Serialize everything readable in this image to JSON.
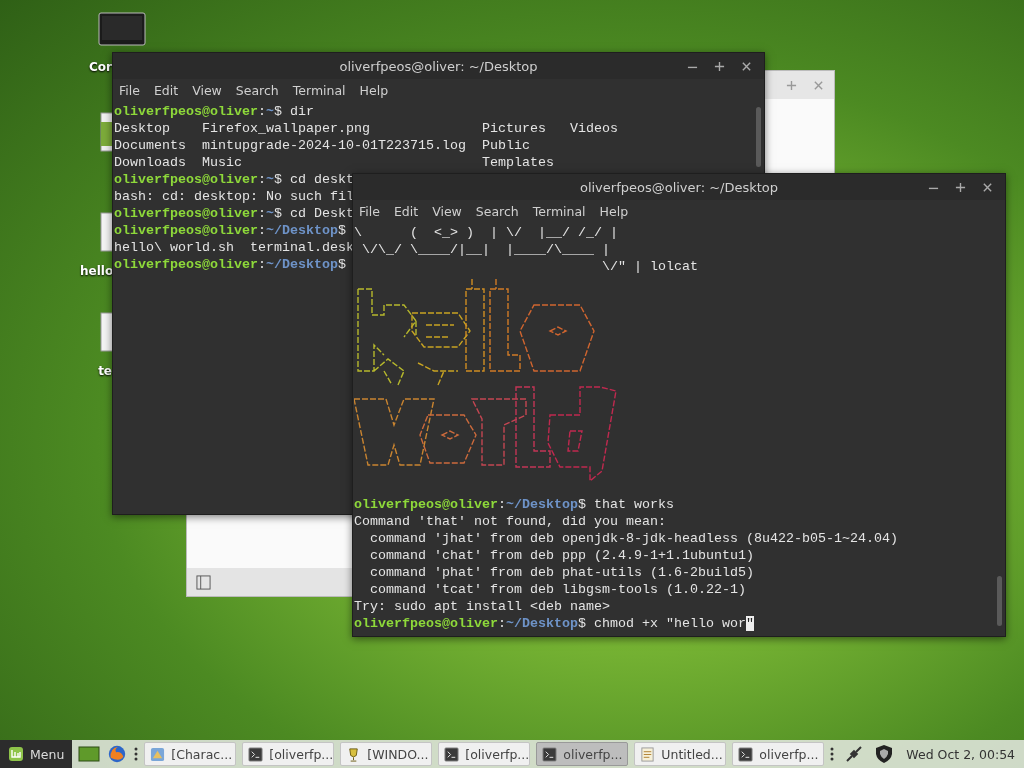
{
  "desktop_icons": [
    {
      "kind": "monitor",
      "label": "Cor"
    },
    {
      "kind": "sheet"
    },
    {
      "kind": "file",
      "label": "hello"
    },
    {
      "kind": "file",
      "label": "te"
    }
  ],
  "terminals": [
    {
      "title": "oliverfpeos@oliver: ~/Desktop",
      "menu": [
        "File",
        "Edit",
        "View",
        "Search",
        "Terminal",
        "Help"
      ],
      "lines": [
        {
          "kind": "prompt",
          "user": "oliverfpeos@oliver",
          "sep": ":",
          "path": "~",
          "dollar": "$",
          "command": "dir"
        },
        {
          "kind": "output",
          "text": "Desktop    Firefox_wallpaper.png              Pictures   Videos"
        },
        {
          "kind": "output",
          "text": "Documents  mintupgrade-2024-10-01T223715.log  Public"
        },
        {
          "kind": "output",
          "text": "Downloads  Music                              Templates"
        },
        {
          "kind": "prompt",
          "user": "oliverfpeos@oliver",
          "sep": ":",
          "path": "~",
          "dollar": "$",
          "command": "cd deskt"
        },
        {
          "kind": "output",
          "text": "bash: cd: desktop: No such fil"
        },
        {
          "kind": "prompt",
          "user": "oliverfpeos@oliver",
          "sep": ":",
          "path": "~",
          "dollar": "$",
          "command": "cd Deskt"
        },
        {
          "kind": "prompt",
          "user": "oliverfpeos@oliver",
          "sep": ":",
          "path": "~/Desktop",
          "dollar": "$"
        },
        {
          "kind": "output",
          "text": "hello\\ world.sh  terminal.desk"
        },
        {
          "kind": "prompt",
          "user": "oliverfpeos@oliver",
          "sep": ":",
          "path": "~/Desktop",
          "dollar": "$"
        }
      ]
    },
    {
      "title": "oliverfpeos@oliver: ~/Desktop",
      "menu": [
        "File",
        "Edit",
        "View",
        "Search",
        "Terminal",
        "Help"
      ],
      "lines": [
        {
          "kind": "output",
          "text": "\\      (  <_> )  | \\/  |__/ /_/ |"
        },
        {
          "kind": "output",
          "text": " \\/\\_/ \\____/|__|  |____/\\____ |"
        },
        {
          "kind": "output",
          "text": "                               \\/\" | lolcat"
        },
        {
          "kind": "art"
        },
        {
          "kind": "prompt",
          "user": "oliverfpeos@oliver",
          "sep": ":",
          "path": "~/Desktop",
          "dollar": "$",
          "command": "that works"
        },
        {
          "kind": "output",
          "text": "Command 'that' not found, did you mean:"
        },
        {
          "kind": "output",
          "text": "  command 'jhat' from deb openjdk-8-jdk-headless (8u422-b05-1~24.04)"
        },
        {
          "kind": "output",
          "text": "  command 'chat' from deb ppp (2.4.9-1+1.1ubuntu1)"
        },
        {
          "kind": "output",
          "text": "  command 'phat' from deb phat-utils (1.6-2build5)"
        },
        {
          "kind": "output",
          "text": "  command 'tcat' from deb libgsm-tools (1.0.22-1)"
        },
        {
          "kind": "output",
          "text": "Try: sudo apt install <deb name>"
        },
        {
          "kind": "prompt",
          "user": "oliverfpeos@oliver",
          "sep": ":",
          "path": "~/Desktop",
          "dollar": "$",
          "command": "chmod +x \"hello wor",
          "cursor": "\""
        }
      ]
    }
  ],
  "taskbar": {
    "menu_label": "Menu",
    "tasks": [
      {
        "kind": "app",
        "label": "[Charac...",
        "selected": false
      },
      {
        "kind": "terminal",
        "label": "[oliverfp...",
        "selected": false
      },
      {
        "kind": "wine",
        "label": "[WINDO...",
        "selected": false
      },
      {
        "kind": "terminal",
        "label": "[oliverfp...",
        "selected": false
      },
      {
        "kind": "terminal",
        "label": "oliverfp...",
        "selected": true
      },
      {
        "kind": "editor",
        "label": "Untitled...",
        "selected": false
      },
      {
        "kind": "terminal",
        "label": "oliverfp...",
        "selected": false
      }
    ],
    "clock": "Wed Oct 2, 00:54"
  }
}
